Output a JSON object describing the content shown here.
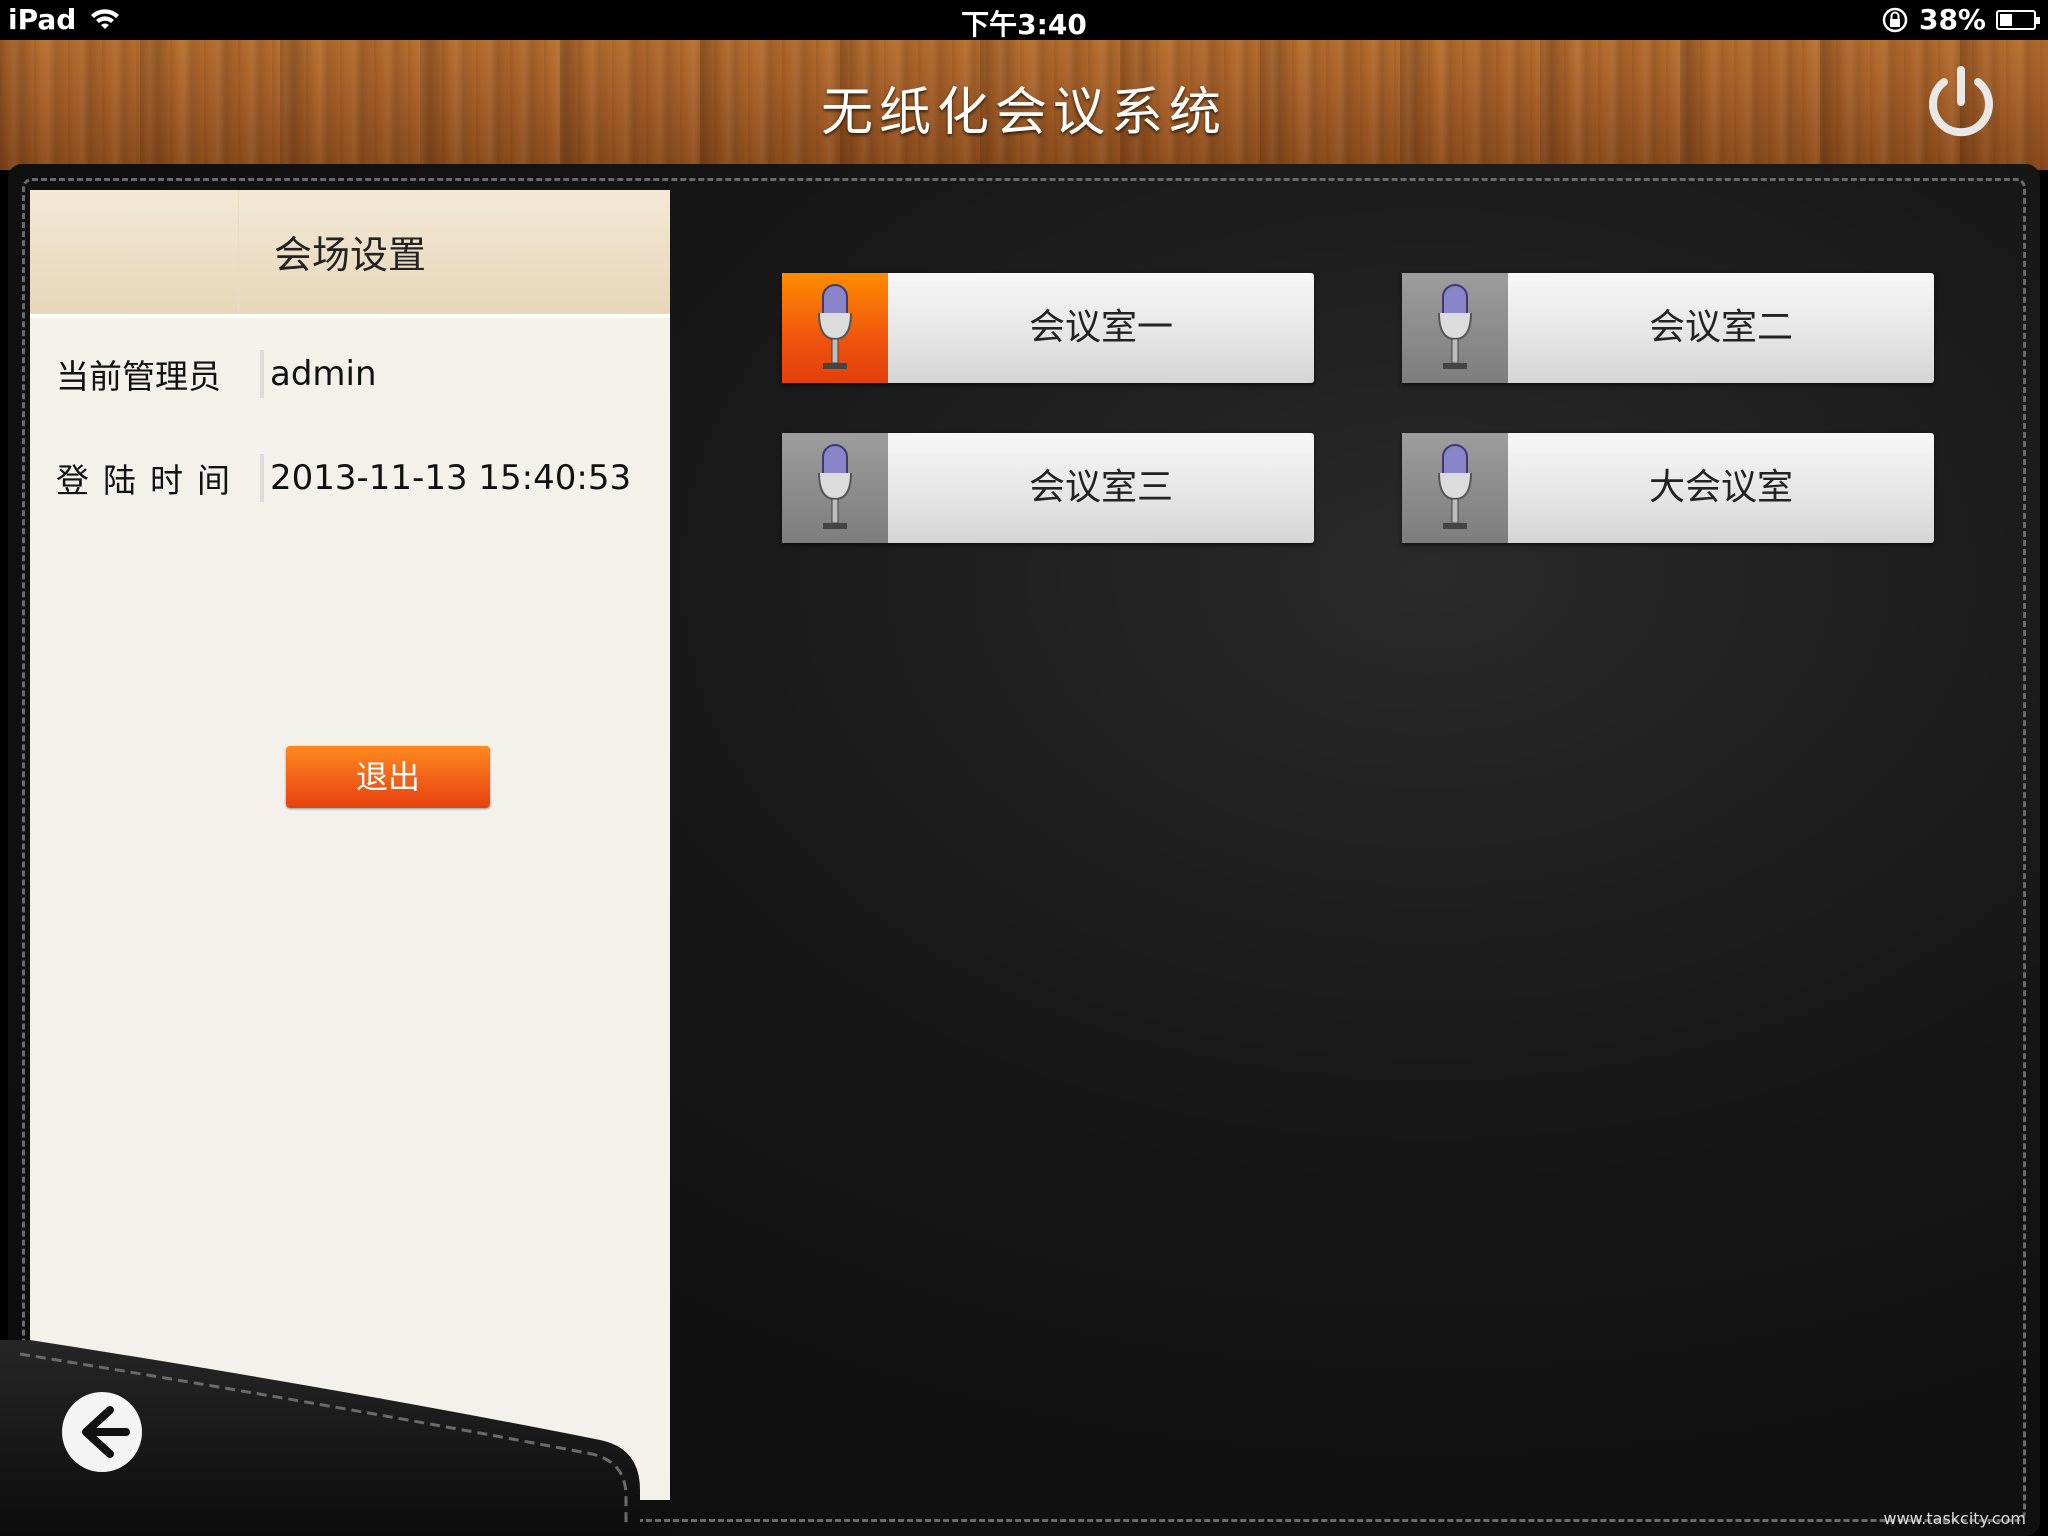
{
  "status_bar": {
    "device": "iPad",
    "time": "下午3:40",
    "battery": "38%",
    "battery_level": 0.38
  },
  "header": {
    "title": "无纸化会议系统",
    "power_icon": "power-icon"
  },
  "side_panel": {
    "title": "会场设置",
    "admin_label": "当前管理员",
    "admin_value": "admin",
    "login_time_label": "登陆时间",
    "login_time_value": "2013-11-13 15:40:53",
    "logout_label": "退出",
    "back_icon": "arrow-left-icon"
  },
  "rooms": [
    {
      "label": "会议室一",
      "active": true,
      "icon": "microphone-icon"
    },
    {
      "label": "会议室二",
      "active": false,
      "icon": "microphone-icon"
    },
    {
      "label": "会议室三",
      "active": false,
      "icon": "microphone-icon"
    },
    {
      "label": "大会议室",
      "active": false,
      "icon": "microphone-icon"
    }
  ],
  "colors": {
    "accent_orange": "#f26418",
    "leather": "#151515",
    "wood": "#a9622a",
    "panel": "#f4f0ea"
  },
  "watermark": "www.taskcity.com"
}
